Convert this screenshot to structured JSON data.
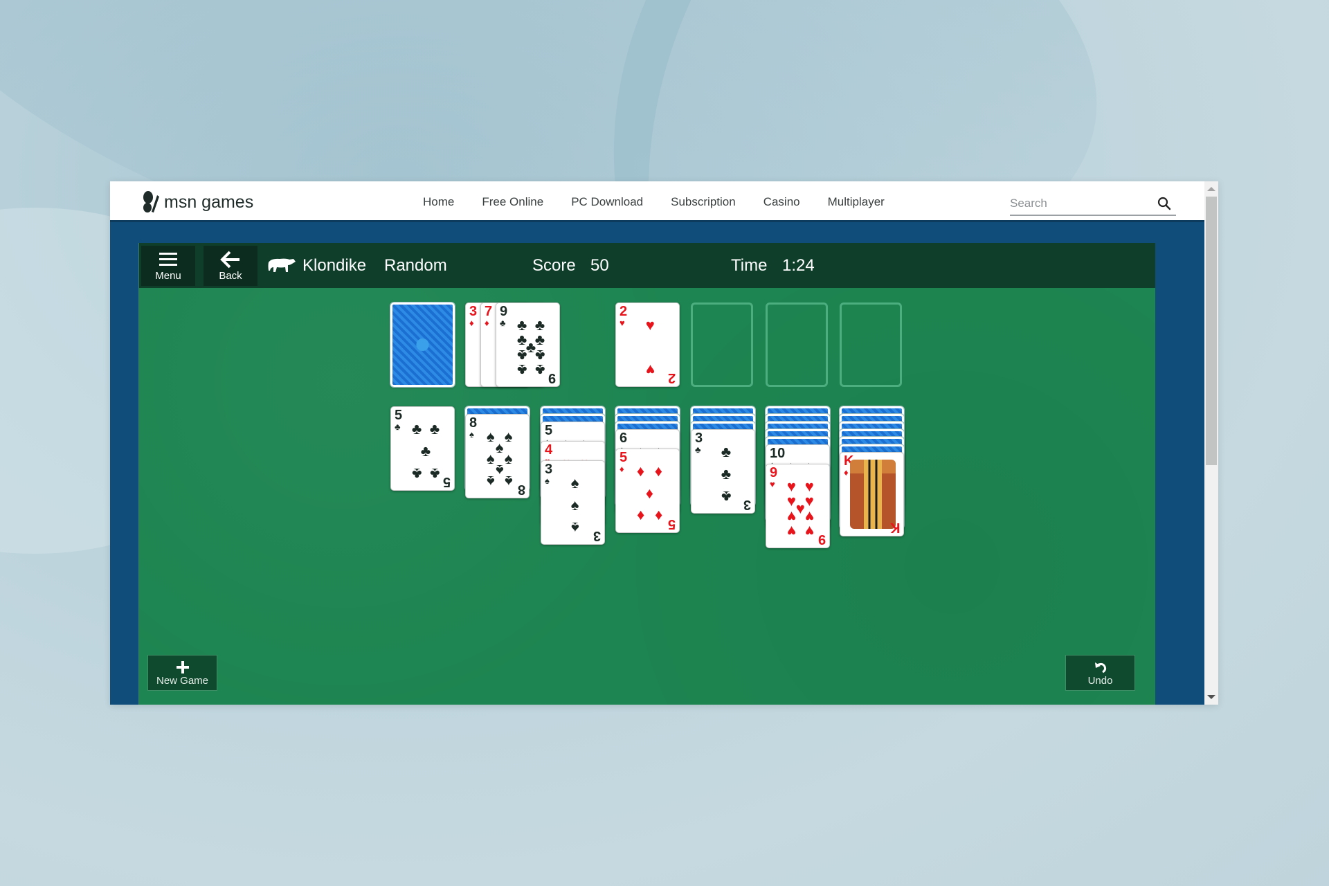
{
  "site": {
    "logo_text": "msn games",
    "nav": [
      "Home",
      "Free Online",
      "PC Download",
      "Subscription",
      "Casino",
      "Multiplayer"
    ],
    "search_placeholder": "Search",
    "search_value": ""
  },
  "toolbar": {
    "menu_label": "Menu",
    "back_label": "Back",
    "game_name": "Klondike",
    "deal_mode": "Random",
    "score_label": "Score",
    "score_value": "50",
    "time_label": "Time",
    "time_value": "1:24"
  },
  "board": {
    "stock": {
      "face_down": true,
      "empty": false
    },
    "waste": [
      {
        "rank": "3",
        "suit": "♦",
        "color": "red"
      },
      {
        "rank": "7",
        "suit": "♦",
        "color": "red"
      },
      {
        "rank": "9",
        "suit": "♣",
        "color": "black"
      }
    ],
    "foundations": [
      {
        "rank": "2",
        "suit": "♥",
        "color": "red"
      },
      null,
      null,
      null
    ],
    "tableau": [
      {
        "face_down": 0,
        "face_up": [
          {
            "rank": "5",
            "suit": "♣",
            "color": "black"
          }
        ]
      },
      {
        "face_down": 1,
        "face_up": [
          {
            "rank": "8",
            "suit": "♠",
            "color": "black"
          }
        ]
      },
      {
        "face_down": 2,
        "face_up": [
          {
            "rank": "5",
            "suit": "♠",
            "color": "black"
          },
          {
            "rank": "4",
            "suit": "♥",
            "color": "red"
          },
          {
            "rank": "3",
            "suit": "♠",
            "color": "black"
          }
        ]
      },
      {
        "face_down": 3,
        "face_up": [
          {
            "rank": "6",
            "suit": "♠",
            "color": "black"
          },
          {
            "rank": "5",
            "suit": "♦",
            "color": "red"
          }
        ]
      },
      {
        "face_down": 3,
        "face_up": [
          {
            "rank": "3",
            "suit": "♣",
            "color": "black"
          }
        ]
      },
      {
        "face_down": 5,
        "face_up": [
          {
            "rank": "10",
            "suit": "♠",
            "color": "black"
          },
          {
            "rank": "9",
            "suit": "♥",
            "color": "red"
          }
        ]
      },
      {
        "face_down": 6,
        "face_up": [
          {
            "rank": "K",
            "suit": "♦",
            "color": "red"
          }
        ]
      }
    ]
  },
  "buttons": {
    "new_game_label": "New Game",
    "undo_label": "Undo"
  },
  "colors": {
    "felt": "#1d8551",
    "toolbar": "#0f3f2b",
    "frame_blue": "#104d7b",
    "card_red": "#e8141c",
    "card_black": "#1c2a26",
    "card_back": "#1a6fd0"
  }
}
